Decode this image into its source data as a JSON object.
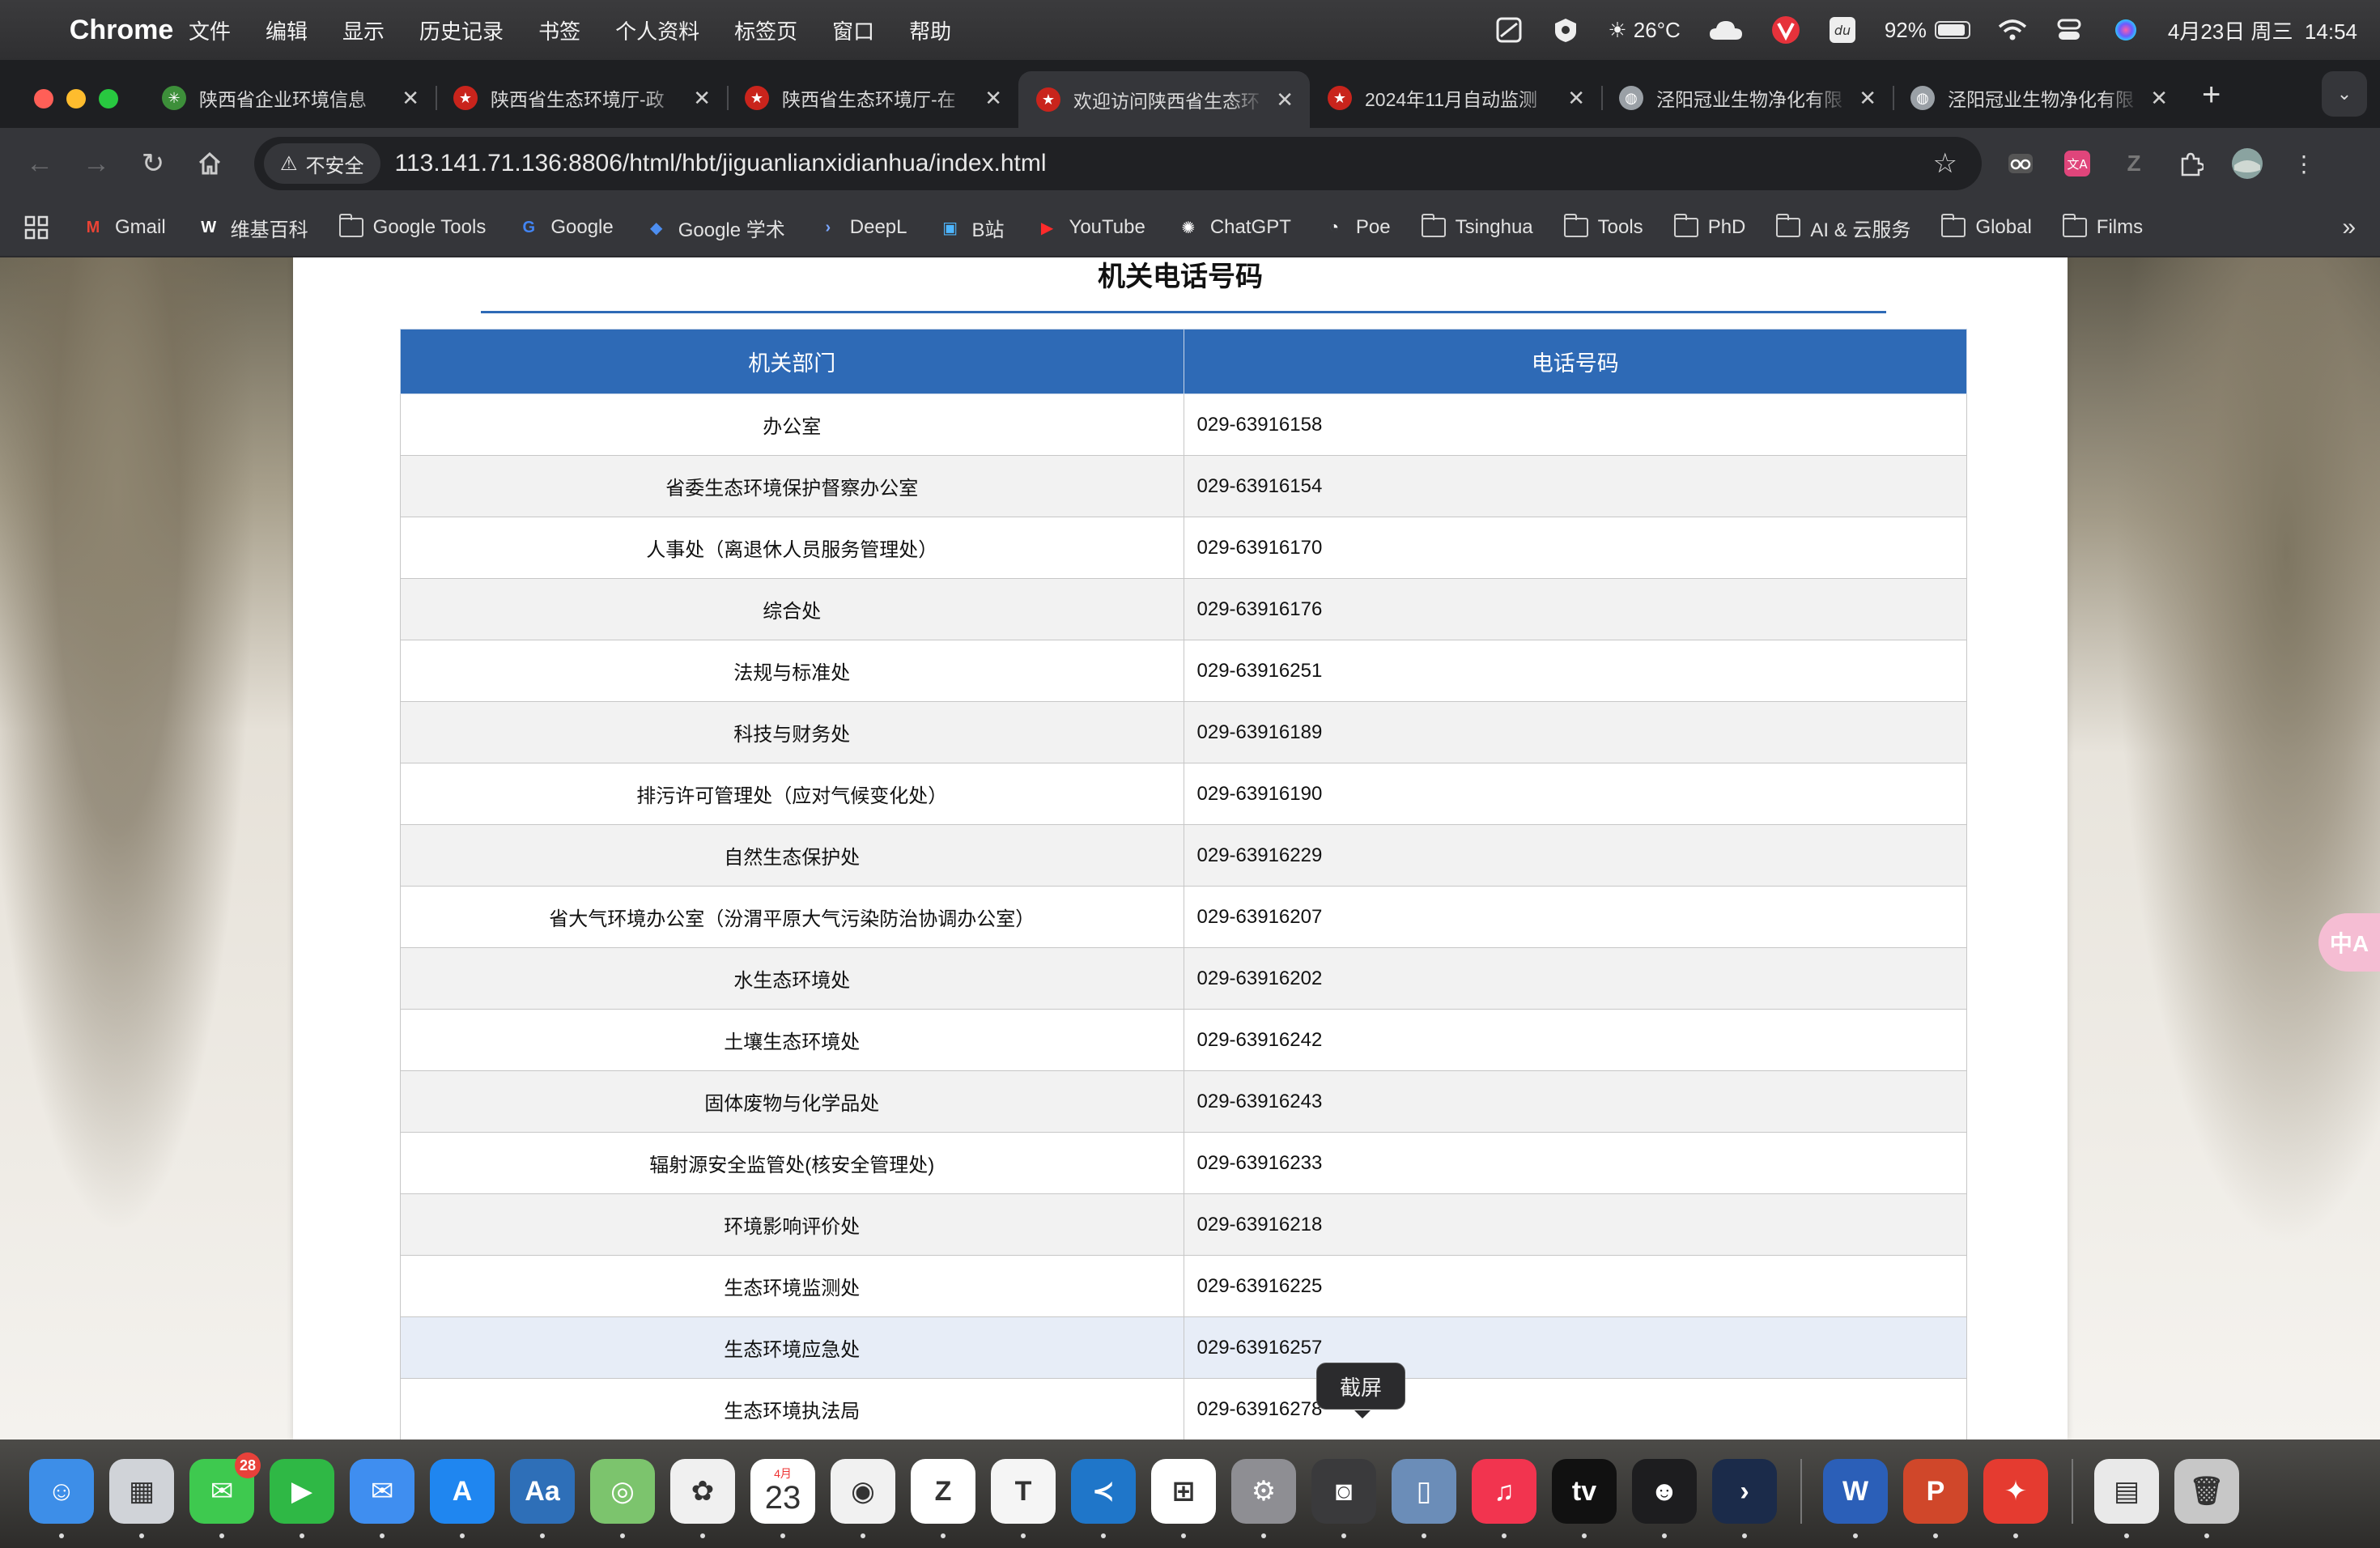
{
  "menubar": {
    "apple": "",
    "app_name": "Chrome",
    "items": [
      "文件",
      "编辑",
      "显示",
      "历史记录",
      "书签",
      "个人资料",
      "标签页",
      "窗口",
      "帮助"
    ],
    "weather": "26°C",
    "battery_percent": "92%",
    "battery_level": 0.92,
    "datetime": "4月23日 周三  14:54"
  },
  "tabs": [
    {
      "title": "陕西省企业环境信息",
      "icon": "leaf-icon",
      "color": "#3d8f3a"
    },
    {
      "title": "陕西省生态环境厅-政",
      "icon": "emblem-icon",
      "color": "#c9241c"
    },
    {
      "title": "陕西省生态环境厅-在",
      "icon": "emblem-icon",
      "color": "#c9241c"
    },
    {
      "title": "欢迎访问陕西省生态环",
      "icon": "emblem-icon",
      "color": "#c9241c",
      "active": true
    },
    {
      "title": "2024年11月自动监测",
      "icon": "emblem-icon",
      "color": "#c9241c"
    },
    {
      "title": "泾阳冠业生物净化有限",
      "icon": "globe-icon",
      "color": "#9aa0a6"
    },
    {
      "title": "泾阳冠业生物净化有限",
      "icon": "globe-icon",
      "color": "#9aa0a6"
    }
  ],
  "toolbar": {
    "security_label": "不安全",
    "url": "113.141.71.136:8806/html/hbt/jiguanlianxidianhua/index.html"
  },
  "bookmarks": [
    {
      "label": "Gmail",
      "icon": "gmail-icon"
    },
    {
      "label": "维基百科",
      "icon": "wikipedia-icon"
    },
    {
      "label": "Google Tools",
      "icon": "folder-icon"
    },
    {
      "label": "Google",
      "icon": "google-icon"
    },
    {
      "label": "Google 学术",
      "icon": "scholar-icon"
    },
    {
      "label": "DeepL",
      "icon": "deepl-icon"
    },
    {
      "label": "B站",
      "icon": "bilibili-icon"
    },
    {
      "label": "YouTube",
      "icon": "youtube-icon"
    },
    {
      "label": "ChatGPT",
      "icon": "chatgpt-icon"
    },
    {
      "label": "Poe",
      "icon": "poe-icon"
    },
    {
      "label": "Tsinghua",
      "icon": "folder-icon"
    },
    {
      "label": "Tools",
      "icon": "folder-icon"
    },
    {
      "label": "PhD",
      "icon": "folder-icon"
    },
    {
      "label": "AI & 云服务",
      "icon": "folder-icon"
    },
    {
      "label": "Global",
      "icon": "folder-icon"
    },
    {
      "label": "Films",
      "icon": "folder-icon"
    }
  ],
  "page": {
    "heading": "机关电话号码",
    "columns": [
      "机关部门",
      "电话号码"
    ],
    "rows": [
      {
        "dept": "办公室",
        "phone": "029-63916158"
      },
      {
        "dept": "省委生态环境保护督察办公室",
        "phone": "029-63916154"
      },
      {
        "dept": "人事处（离退休人员服务管理处）",
        "phone": "029-63916170"
      },
      {
        "dept": "综合处",
        "phone": "029-63916176"
      },
      {
        "dept": "法规与标准处",
        "phone": "029-63916251"
      },
      {
        "dept": "科技与财务处",
        "phone": "029-63916189"
      },
      {
        "dept": "排污许可管理处（应对气候变化处）",
        "phone": "029-63916190"
      },
      {
        "dept": "自然生态保护处",
        "phone": "029-63916229"
      },
      {
        "dept": "省大气环境办公室（汾渭平原大气污染防治协调办公室）",
        "phone": "029-63916207"
      },
      {
        "dept": "水生态环境处",
        "phone": "029-63916202"
      },
      {
        "dept": "土壤生态环境处",
        "phone": "029-63916242"
      },
      {
        "dept": "固体废物与化学品处",
        "phone": "029-63916243"
      },
      {
        "dept": "辐射源安全监管处(核安全管理处)",
        "phone": "029-63916233"
      },
      {
        "dept": "环境影响评价处",
        "phone": "029-63916218"
      },
      {
        "dept": "生态环境监测处",
        "phone": "029-63916225"
      },
      {
        "dept": "生态环境应急处",
        "phone": "029-63916257"
      },
      {
        "dept": "生态环境执法局",
        "phone": "029-63916278"
      }
    ],
    "hover_row_index": 15,
    "tooltip": "截屏",
    "translate_bubble": "中A",
    "accent_color": "#2e6ab6"
  },
  "dock": {
    "apps": [
      {
        "name": "finder",
        "color": "#3d8ee8",
        "glyph": "☺"
      },
      {
        "name": "launchpad",
        "color": "#d0d3d8",
        "glyph": "▦"
      },
      {
        "name": "messages",
        "color": "#3ec94f",
        "glyph": "✉",
        "badge": "28"
      },
      {
        "name": "facetime",
        "color": "#2fb845",
        "glyph": "▶"
      },
      {
        "name": "mail",
        "color": "#3f8ef0",
        "glyph": "✉"
      },
      {
        "name": "app-store",
        "color": "#1f86f0",
        "glyph": "A"
      },
      {
        "name": "dictionary",
        "color": "#2e6fb8",
        "glyph": "Aa"
      },
      {
        "name": "maps",
        "color": "#7cc46d",
        "glyph": "◎"
      },
      {
        "name": "photos",
        "color": "#f0f0f0",
        "glyph": "✿"
      },
      {
        "name": "calendar",
        "color": "#ffffff",
        "glyph": "23",
        "month": "4月"
      },
      {
        "name": "chrome",
        "color": "#f1f1f1",
        "glyph": "◉"
      },
      {
        "name": "zotero",
        "color": "#ffffff",
        "glyph": "Z"
      },
      {
        "name": "typora",
        "color": "#f5f5f5",
        "glyph": "T"
      },
      {
        "name": "vscode",
        "color": "#1f76c9",
        "glyph": "≺"
      },
      {
        "name": "windows-app",
        "color": "#ffffff",
        "glyph": "⊞"
      },
      {
        "name": "system-settings",
        "color": "#8e8e93",
        "glyph": "⚙"
      },
      {
        "name": "screenshot",
        "color": "#3a3a3c",
        "glyph": "◙"
      },
      {
        "name": "iphone-mirroring",
        "color": "#6b8db8",
        "glyph": "▯"
      },
      {
        "name": "music",
        "color": "#f2344f",
        "glyph": "♫"
      },
      {
        "name": "apple-tv",
        "color": "#111111",
        "glyph": "tv"
      },
      {
        "name": "chat-app",
        "color": "#1d1d1f",
        "glyph": "☻"
      },
      {
        "name": "prompt-app",
        "color": "#1b2b4a",
        "glyph": "›"
      },
      {
        "name": "word",
        "color": "#2b5fb8",
        "glyph": "W"
      },
      {
        "name": "powerpoint",
        "color": "#d0472a",
        "glyph": "P"
      },
      {
        "name": "acrobat",
        "color": "#e53b30",
        "glyph": "✦"
      },
      {
        "name": "document-stack",
        "color": "#e9e9e9",
        "glyph": "▤"
      },
      {
        "name": "trash",
        "color": "#c7c7c7",
        "glyph": "🗑"
      }
    ]
  }
}
